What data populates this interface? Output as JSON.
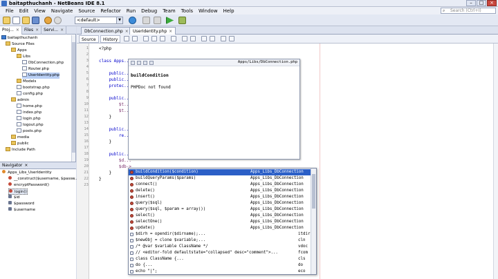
{
  "window": {
    "title": "baitapthuchanh - NetBeans IDE 8.1"
  },
  "menu": [
    "File",
    "Edit",
    "View",
    "Navigate",
    "Source",
    "Refactor",
    "Run",
    "Debug",
    "Team",
    "Tools",
    "Window",
    "Help"
  ],
  "search": {
    "placeholder": "Search (Ctrl+I)"
  },
  "toolbar": {
    "config": "<default>"
  },
  "left_tabs": [
    "Proj...",
    "Files",
    "Servi..."
  ],
  "tree": [
    {
      "label": "baitapthuchanh",
      "type": "proj"
    },
    {
      "label": "Source Files",
      "type": "folder"
    },
    {
      "label": "Apps",
      "type": "folder"
    },
    {
      "label": "Libs",
      "type": "folder"
    },
    {
      "label": "DbConnection.php",
      "type": "php"
    },
    {
      "label": "Router.php",
      "type": "php"
    },
    {
      "label": "UserIdentity.php",
      "type": "php",
      "selected": true
    },
    {
      "label": "Models",
      "type": "folder"
    },
    {
      "label": "bootstrap.php",
      "type": "php"
    },
    {
      "label": "config.php",
      "type": "php"
    },
    {
      "label": "admin",
      "type": "folder"
    },
    {
      "label": "home.php",
      "type": "php"
    },
    {
      "label": "index.php",
      "type": "php"
    },
    {
      "label": "login.php",
      "type": "php"
    },
    {
      "label": "logout.php",
      "type": "php"
    },
    {
      "label": "posts.php",
      "type": "php"
    },
    {
      "label": "media",
      "type": "folder"
    },
    {
      "label": "public",
      "type": "folder"
    },
    {
      "label": "Include Path",
      "type": "folder"
    }
  ],
  "navigator": {
    "title": "Navigator",
    "items": [
      {
        "label": "Apps_Libs_UserIdentity"
      },
      {
        "label": "__construct($username, $passw..."
      },
      {
        "label": "encryptPassword()"
      },
      {
        "label": "login()"
      },
      {
        "label": "$id"
      },
      {
        "label": "$password"
      },
      {
        "label": "$username"
      }
    ]
  },
  "editor": {
    "tabs": [
      "DbConnection.php",
      "UserIdentity.php"
    ],
    "active_tab": "UserIdentity.php",
    "mode_source": "Source",
    "mode_history": "History",
    "line_numbers": [
      "1",
      "2",
      "3",
      "4",
      "5",
      "6",
      "7",
      "8",
      "9",
      "10",
      "11",
      "12",
      "13",
      "14",
      "15",
      "16",
      "17",
      "18",
      "19",
      "20",
      "21",
      "22",
      "23"
    ],
    "code_lines": [
      "<?php",
      "",
      "class Apps...",
      "",
      "    public...",
      "    public...",
      "    protec...",
      "",
      "    public...",
      "        $t...",
      "        $t...",
      "    }",
      "",
      "    public...",
      "        re...",
      "    }",
      "",
      "    public...",
      "        $d...",
      "        $db->",
      "    }",
      "}",
      ""
    ]
  },
  "doc_popup": {
    "path": "Apps/Libs/DbConnection.php",
    "name": "buildCondition",
    "message": "PHPDoc not found"
  },
  "completion": {
    "items": [
      {
        "text": "buildCondition($condition)",
        "origin": "Apps_Libs_DbConnection",
        "kind": "method",
        "selected": true
      },
      {
        "text": "buildQueryParams($params)",
        "origin": "Apps_Libs_DbConnection",
        "kind": "method"
      },
      {
        "text": "connect()",
        "origin": "Apps_Libs_DbConnection",
        "kind": "method"
      },
      {
        "text": "delete()",
        "origin": "Apps_Libs_DbConnection",
        "kind": "method"
      },
      {
        "text": "insert()",
        "origin": "Apps_Libs_DbConnection",
        "kind": "method"
      },
      {
        "text": "query($sql)",
        "origin": "Apps_Libs_DbConnection",
        "kind": "method"
      },
      {
        "text": "query($sql, $param = array())",
        "origin": "Apps_Libs_DbConnection",
        "kind": "method"
      },
      {
        "text": "select()",
        "origin": "Apps_Libs_DbConnection",
        "kind": "method"
      },
      {
        "text": "selectOne()",
        "origin": "Apps_Libs_DbConnection",
        "kind": "method"
      },
      {
        "text": "update()",
        "origin": "Apps_Libs_DbConnection",
        "kind": "method"
      },
      {
        "text": "$dirh = opendir($dirname);...",
        "origin": "itdir",
        "kind": "template"
      },
      {
        "text": "$newObj = clone $variable;...",
        "origin": "cln",
        "kind": "template"
      },
      {
        "text": "/* @var $variable ClassName */",
        "origin": "vdoc",
        "kind": "template"
      },
      {
        "text": "// <editor-fold defaultstate=\"collapsed\" desc=\"comment\">...",
        "origin": "fcom",
        "kind": "template"
      },
      {
        "text": "class ClassName {...",
        "origin": "cls",
        "kind": "template"
      },
      {
        "text": "do {...",
        "origin": "do",
        "kind": "template"
      },
      {
        "text": "echo \"|\";",
        "origin": "eco",
        "kind": "template"
      }
    ]
  },
  "colors": {
    "selection": "#2b5fc7",
    "method_icon": "#c44a3a",
    "keyword": "#0000cc"
  }
}
